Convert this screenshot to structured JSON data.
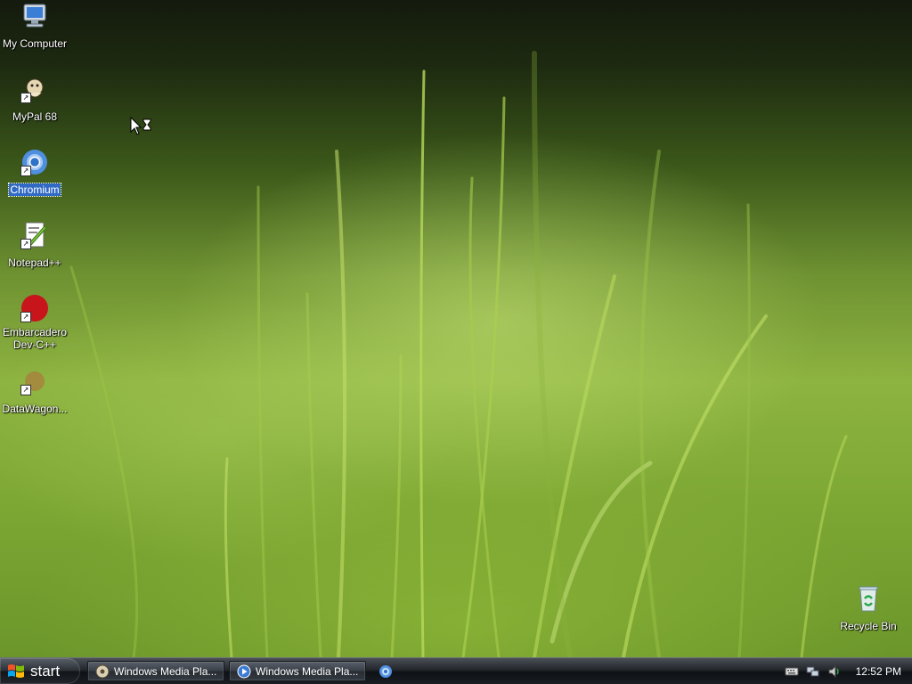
{
  "desktop_icons": [
    {
      "label": "My Computer",
      "icon": "computer-icon",
      "shortcut": false
    },
    {
      "label": "MyPal 68",
      "icon": "mypal-icon",
      "shortcut": true
    },
    {
      "label": "Chromium",
      "icon": "chromium-icon",
      "shortcut": true,
      "selected": true
    },
    {
      "label": "Notepad++",
      "icon": "notepadpp-icon",
      "shortcut": true
    },
    {
      "label": "Embarcadero Dev-C++",
      "icon": "devcpp-icon",
      "shortcut": true
    },
    {
      "label": "DataWagon...",
      "icon": "datawagon-icon",
      "shortcut": true
    },
    {
      "label": "Recycle Bin",
      "icon": "recycle-bin-icon",
      "shortcut": false
    }
  ],
  "taskbar": {
    "start_label": "start",
    "tasks": [
      {
        "label": "Windows Media Pla...",
        "icon": "media-player-icon"
      },
      {
        "label": "Windows Media Pla...",
        "icon": "media-player-icon"
      }
    ],
    "quick_launch": [
      {
        "icon": "chromium-icon"
      }
    ],
    "tray": {
      "icons": [
        "keyboard-icon",
        "network-icon",
        "volume-icon"
      ],
      "clock": "12:52 PM"
    }
  },
  "colors": {
    "selection": "#316ac5",
    "taskbar": "#1a1e23",
    "wallpaper": "#8db340"
  }
}
